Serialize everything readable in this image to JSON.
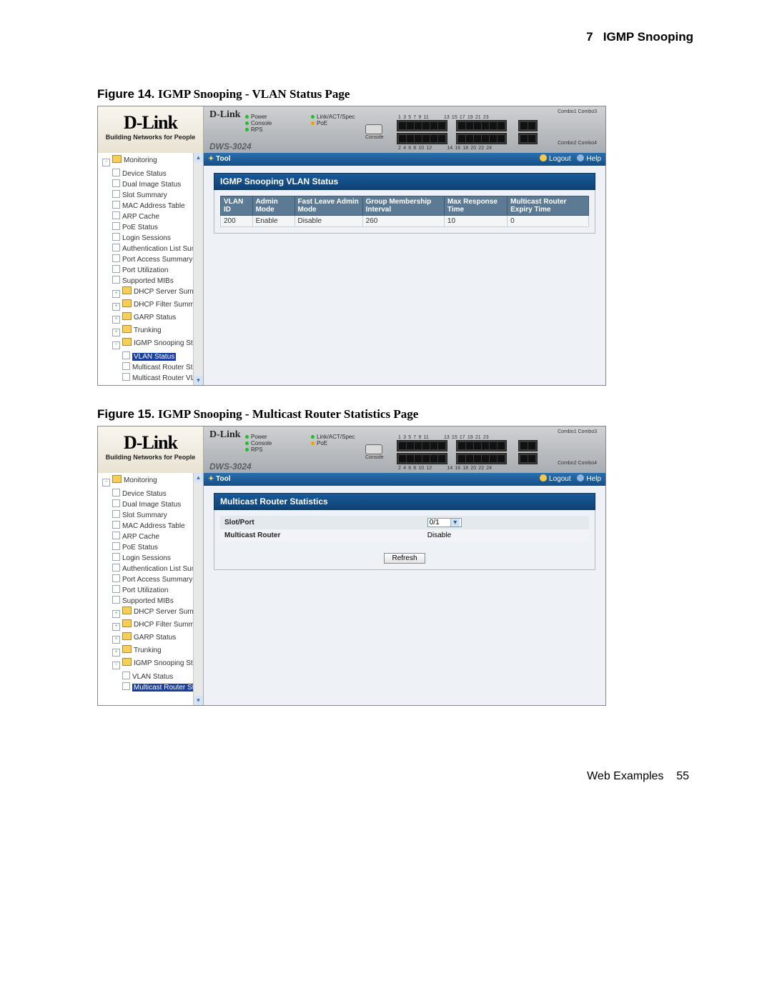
{
  "header": {
    "section": "7",
    "title": "IGMP Snooping"
  },
  "figures": [
    {
      "num": "Figure 14.",
      "title": "IGMP Snooping - VLAN Status Page"
    },
    {
      "num": "Figure 15.",
      "title": "IGMP Snooping - Multicast Router Statistics Page"
    }
  ],
  "footer": {
    "label": "Web Examples",
    "page": "55"
  },
  "brand": {
    "logo": "D-Link",
    "tag": "Building Networks for People"
  },
  "device": {
    "logo": "D-Link",
    "model": "DWS-3024",
    "leds": {
      "power": "Power",
      "console": "Console",
      "rps": "RPS",
      "link": "Link/ACT/Spec",
      "poe": "PoE"
    },
    "portTopNums": [
      "1",
      "3",
      "5",
      "7",
      "9",
      "11",
      "13",
      "15",
      "17",
      "19",
      "21",
      "23"
    ],
    "portBotNums": [
      "2",
      "4",
      "6",
      "8",
      "10",
      "12",
      "14",
      "16",
      "18",
      "20",
      "22",
      "24"
    ],
    "consoleLabel": "Console",
    "combo": [
      "Combo1 Combo3",
      "Combo2 Combo4"
    ]
  },
  "toolbar": {
    "tool": "Tool",
    "logout": "Logout",
    "help": "Help"
  },
  "nav": {
    "root": "Monitoring",
    "items": [
      "Device Status",
      "Dual Image Status",
      "Slot Summary",
      "MAC Address Table",
      "ARP Cache",
      "PoE Status",
      "Login Sessions",
      "Authentication List Sum",
      "Port Access Summary",
      "Port Utilization",
      "Supported MIBs"
    ],
    "folders": [
      "DHCP Server Summar",
      "DHCP Filter Summary",
      "GARP Status",
      "Trunking"
    ],
    "igmp": {
      "label": "IGMP Snooping Status",
      "children": [
        "VLAN Status",
        "Multicast Router Sta",
        "Multicast Router VL"
      ]
    }
  },
  "screens": {
    "vlan": {
      "title": "IGMP Snooping VLAN Status",
      "headers": [
        "VLAN ID",
        "Admin Mode",
        "Fast Leave Admin Mode",
        "Group Membership Interval",
        "Max Response Time",
        "Multicast Router Expiry Time"
      ],
      "row": [
        "200",
        "Enable",
        "Disable",
        "260",
        "10",
        "0"
      ]
    },
    "mrs": {
      "title": "Multicast Router Statistics",
      "rows": [
        {
          "label": "Slot/Port",
          "value": "0/1",
          "select": true
        },
        {
          "label": "Multicast Router",
          "value": "Disable",
          "select": false
        }
      ],
      "refresh": "Refresh"
    }
  }
}
